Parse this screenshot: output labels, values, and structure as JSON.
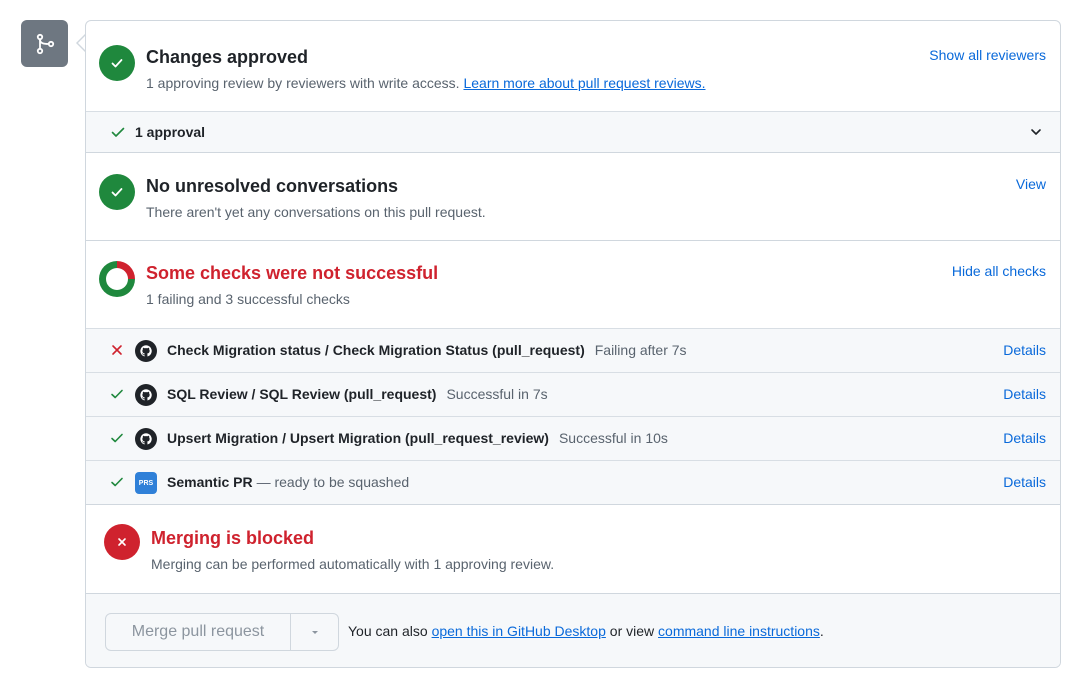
{
  "colors": {
    "green": "#1f883d",
    "red": "#cf222e",
    "link": "#0969da",
    "muted": "#59636e",
    "icon_box": "#6e7781"
  },
  "sidebar_icon": "git-merge-icon",
  "reviews": {
    "title": "Changes approved",
    "subtitle": "1 approving review by reviewers with write access.",
    "learn_more_link": "Learn more about pull request reviews.",
    "action": "Show all reviewers",
    "approval_summary": "1 approval"
  },
  "conversations": {
    "title": "No unresolved conversations",
    "subtitle": "There aren't yet any conversations on this pull request.",
    "action": "View"
  },
  "checks": {
    "title": "Some checks were not successful",
    "subtitle": "1 failing and 3 successful checks",
    "action": "Hide all checks",
    "items": [
      {
        "status": "failing",
        "icon": "github-icon",
        "name": "Check Migration status / Check Migration Status (pull_request)",
        "description": "Failing after 7s",
        "details": "Details"
      },
      {
        "status": "success",
        "icon": "github-icon",
        "name": "SQL Review / SQL Review (pull_request)",
        "description": "Successful in 7s",
        "details": "Details"
      },
      {
        "status": "success",
        "icon": "github-icon",
        "name": "Upsert Migration / Upsert Migration (pull_request_review)",
        "description": "Successful in 10s",
        "details": "Details"
      },
      {
        "status": "success",
        "icon": "semantic-prs-icon",
        "name": "Semantic PR",
        "description": "— ready to be squashed",
        "details": "Details"
      }
    ]
  },
  "merge_status": {
    "title": "Merging is blocked",
    "subtitle": "Merging can be performed automatically with 1 approving review."
  },
  "footer": {
    "merge_button": "Merge pull request",
    "text_prefix": "You can also",
    "desktop_link": "open this in GitHub Desktop",
    "text_middle": "or view",
    "cli_link": "command line instructions",
    "text_suffix": "."
  }
}
